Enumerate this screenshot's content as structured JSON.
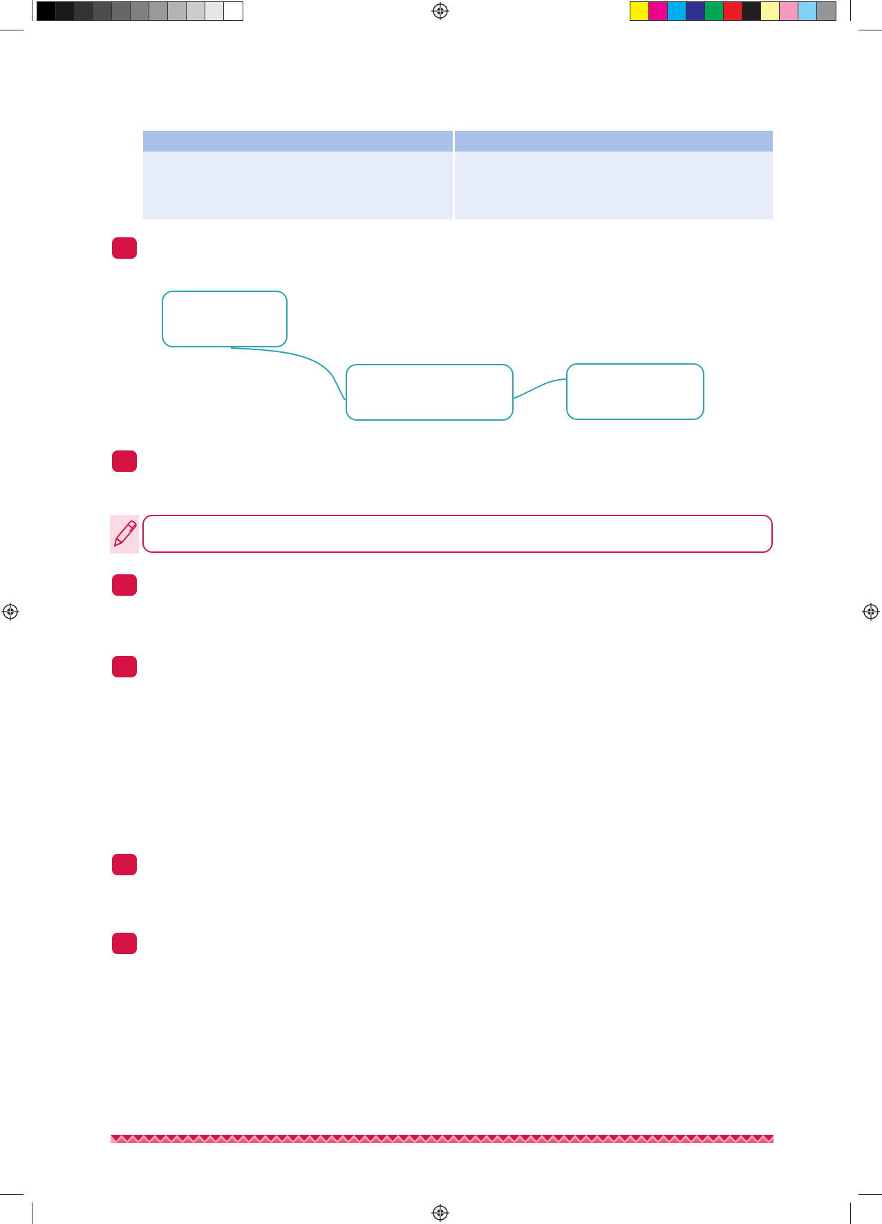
{
  "colors": {
    "table_header": "#a8c1e8",
    "table_cell": "#e6ecf8",
    "question_marker": "#d51444",
    "diagram_stroke": "#2ba5b0",
    "note_border": "#d51444",
    "pen_background": "#fadbe3"
  },
  "grayscale_swatches": [
    "#000000",
    "#1a1a1a",
    "#333333",
    "#4d4d4d",
    "#666666",
    "#808080",
    "#999999",
    "#b3b3b3",
    "#cccccc",
    "#e6e6e6",
    "#ffffff"
  ],
  "color_swatches": [
    "#fff200",
    "#ec008c",
    "#00aeef",
    "#2e3192",
    "#00a651",
    "#ed1c24",
    "#231f20",
    "#fff799",
    "#f49ac1",
    "#7fd3f7",
    "#939598"
  ],
  "icons": {
    "registration": "registration-target-icon",
    "pen": "pen-icon"
  },
  "table": {
    "headers": [
      "",
      ""
    ],
    "rows": [
      [
        "",
        ""
      ]
    ]
  },
  "diagram": {
    "boxes": [
      "",
      "",
      ""
    ]
  },
  "notes": {
    "text": ""
  }
}
